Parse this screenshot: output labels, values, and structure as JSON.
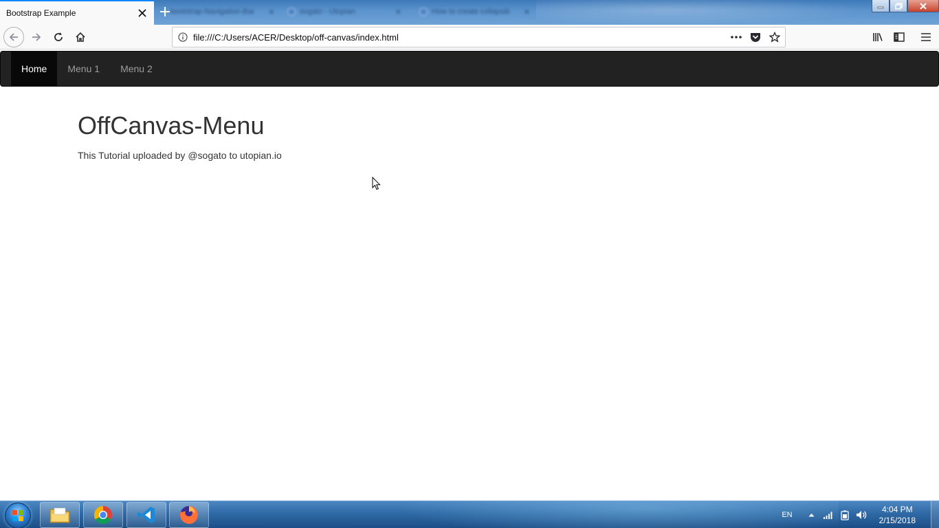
{
  "browser": {
    "active_tab": {
      "title": "Bootstrap Example"
    },
    "background_tabs": [
      {
        "title": "bootstrap-Navigation-Bar"
      },
      {
        "title": "sogato - Utopian"
      },
      {
        "title": "How to create collapsib"
      }
    ],
    "url": "file:///C:/Users/ACER/Desktop/off-canvas/index.html"
  },
  "page": {
    "nav": {
      "items": [
        {
          "label": "Home",
          "active": true
        },
        {
          "label": "Menu 1",
          "active": false
        },
        {
          "label": "Menu 2",
          "active": false
        }
      ]
    },
    "title": "OffCanvas-Menu",
    "subtitle": "This Tutorial uploaded by @sogato to utopian.io"
  },
  "taskbar": {
    "language": "EN",
    "time": "4:04 PM",
    "date": "2/15/2018",
    "apps": [
      "folder-icon",
      "chrome-icon",
      "vscode-icon",
      "firefox-icon"
    ]
  },
  "colors": {
    "navbar_bg": "#222222",
    "navbar_active_bg": "#080808",
    "accent": "#0a84ff"
  }
}
